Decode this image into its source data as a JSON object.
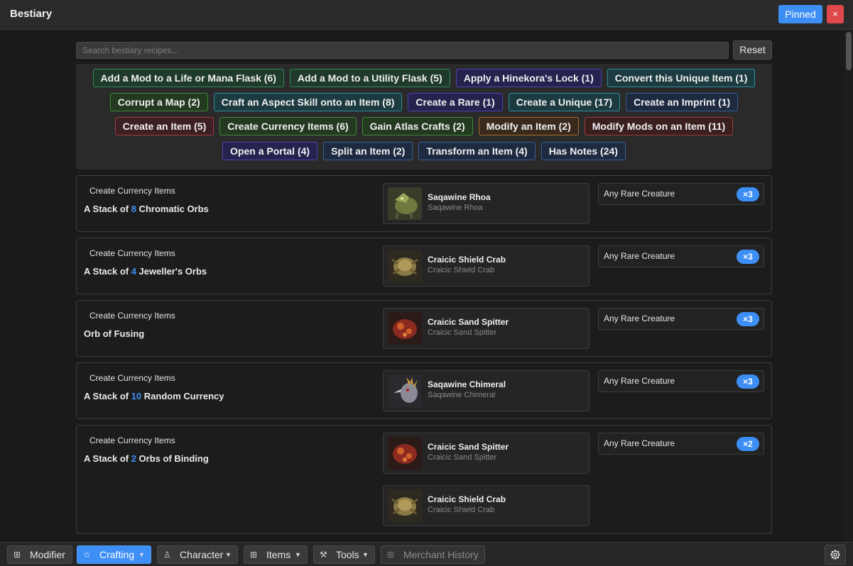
{
  "window": {
    "title": "Bestiary",
    "pinned_label": "Pinned",
    "close_label": "×"
  },
  "search": {
    "placeholder": "Search bestiary recipes...",
    "value": "",
    "reset_label": "Reset"
  },
  "filters": [
    [
      "Add a Mod to a Life or Mana Flask (6)",
      "Add a Mod to a Utility Flask (5)",
      "Apply a Hinekora's Lock (1)",
      "Convert this Unique Item (1)"
    ],
    [
      "Corrupt a Map (2)",
      "Craft an Aspect Skill onto an Item (8)",
      "Create a Rare (1)",
      "Create a Unique (17)",
      "Create an Imprint (1)"
    ],
    [
      "Create an Item (5)",
      "Create Currency Items (6)",
      "Gain Atlas Crafts (2)",
      "Modify an Item (2)",
      "Modify Mods on an Item (11)"
    ],
    [
      "Open a Portal (4)",
      "Split an Item (2)",
      "Transform an Item (4)",
      "Has Notes (24)"
    ]
  ],
  "recipes": [
    {
      "category": "Create Currency Items",
      "name_pre": "A Stack of ",
      "name_num": "8",
      "name_post": " Chromatic Orbs",
      "beasts": [
        {
          "name": "Saqawine Rhoa",
          "sub": "Saqawine Rhoa",
          "icon": "rhoa-icon"
        }
      ],
      "requirement": "Any Rare Creature",
      "count": "×3"
    },
    {
      "category": "Create Currency Items",
      "name_pre": "A Stack of ",
      "name_num": "4",
      "name_post": " Jeweller's Orbs",
      "beasts": [
        {
          "name": "Craicic Shield Crab",
          "sub": "Craicic Shield Crab",
          "icon": "crab-icon"
        }
      ],
      "requirement": "Any Rare Creature",
      "count": "×3"
    },
    {
      "category": "Create Currency Items",
      "name_pre": "Orb of Fusing",
      "name_num": "",
      "name_post": "",
      "beasts": [
        {
          "name": "Craicic Sand Spitter",
          "sub": "Craicic Sand Spitter",
          "icon": "spitter-icon"
        }
      ],
      "requirement": "Any Rare Creature",
      "count": "×3"
    },
    {
      "category": "Create Currency Items",
      "name_pre": "A Stack of ",
      "name_num": "10",
      "name_post": " Random Currency",
      "beasts": [
        {
          "name": "Saqawine Chimeral",
          "sub": "Saqawine Chimeral",
          "icon": "chimeral-icon"
        }
      ],
      "requirement": "Any Rare Creature",
      "count": "×3"
    },
    {
      "category": "Create Currency Items",
      "name_pre": "A Stack of ",
      "name_num": "2",
      "name_post": " Orbs of Binding",
      "beasts": [
        {
          "name": "Craicic Sand Spitter",
          "sub": "Craicic Sand Spitter",
          "icon": "spitter-icon"
        },
        {
          "name": "Craicic Shield Crab",
          "sub": "Craicic Shield Crab",
          "icon": "crab-icon"
        }
      ],
      "requirement": "Any Rare Creature",
      "count": "×2"
    }
  ],
  "bottom_nav": [
    {
      "label": "Modifier",
      "icon": "grid-icon",
      "caret": false,
      "active": false,
      "disabled": false
    },
    {
      "label": "Crafting",
      "icon": "star-icon",
      "caret": true,
      "active": true,
      "disabled": false
    },
    {
      "label": "Character",
      "icon": "person-icon",
      "caret": true,
      "active": false,
      "disabled": false
    },
    {
      "label": "Items",
      "icon": "grid-icon",
      "caret": true,
      "active": false,
      "disabled": false
    },
    {
      "label": "Tools",
      "icon": "wrench-icon",
      "caret": true,
      "active": false,
      "disabled": false
    },
    {
      "label": "Merchant History",
      "icon": "grid-icon",
      "caret": false,
      "active": false,
      "disabled": true
    }
  ],
  "settings_icon": "gear-icon",
  "colors": {
    "accent": "#3d8ef5",
    "danger": "#e0494c",
    "background": "#1a1a1a"
  }
}
